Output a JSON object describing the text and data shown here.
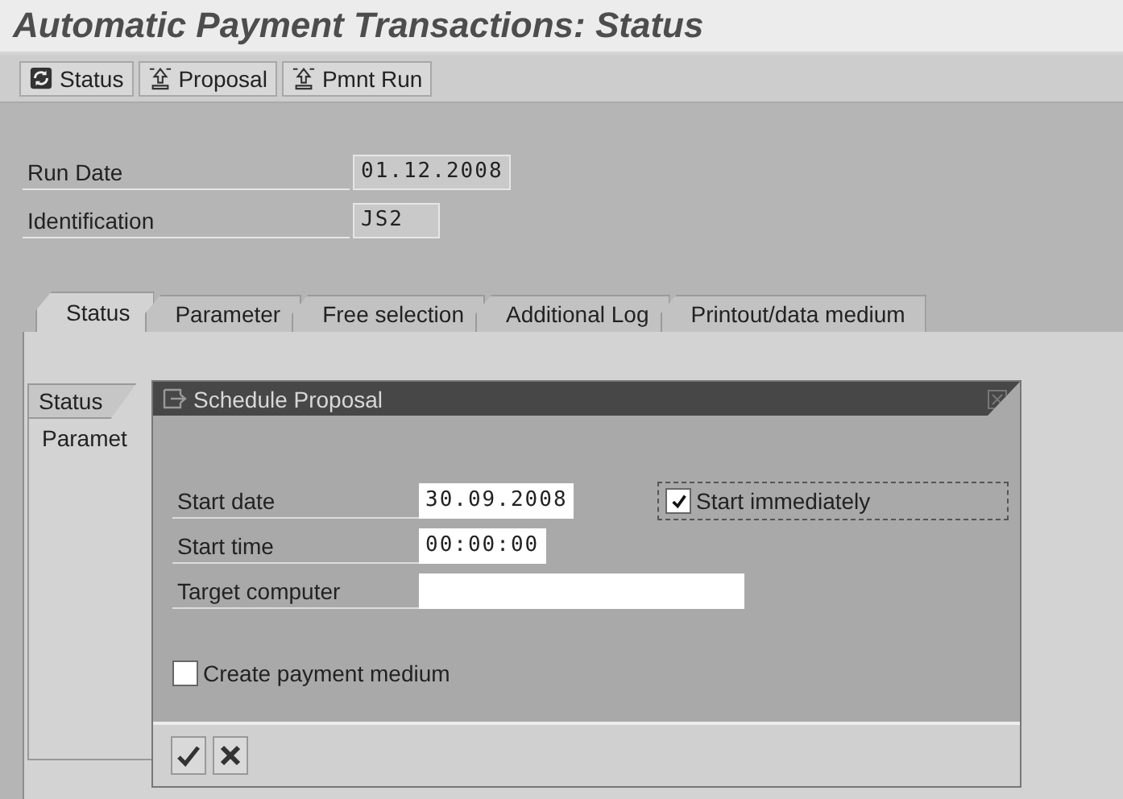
{
  "window": {
    "title": "Automatic Payment Transactions: Status"
  },
  "toolbar": [
    {
      "label": "Status",
      "kind": "refresh"
    },
    {
      "label": "Proposal",
      "kind": "upload"
    },
    {
      "label": "Pmnt Run",
      "kind": "upload"
    }
  ],
  "header_fields": [
    {
      "label": "Run Date",
      "value": "01.12.2008"
    },
    {
      "label": "Identification",
      "value": "JS2"
    }
  ],
  "tabs": [
    {
      "label": "Status",
      "selected": true
    },
    {
      "label": "Parameter",
      "selected": false
    },
    {
      "label": "Free selection",
      "selected": false
    },
    {
      "label": "Additional Log",
      "selected": false
    },
    {
      "label": "Printout/data medium",
      "selected": false
    }
  ],
  "inner_tab": {
    "label": "Status"
  },
  "inner_rows": [
    "Paramet"
  ],
  "dialog": {
    "title": "Schedule Proposal",
    "fields": [
      {
        "label": "Start date",
        "value": "30.09.2008"
      },
      {
        "label": "Start time",
        "value": "00:00:00"
      },
      {
        "label": "Target computer"
      }
    ],
    "start_immediately": {
      "label": "Start immediately",
      "checked": true
    },
    "create_payment_medium": {
      "label": "Create payment medium",
      "checked": false
    },
    "buttons": [
      {
        "kind": "confirm"
      },
      {
        "kind": "cancel"
      }
    ]
  }
}
